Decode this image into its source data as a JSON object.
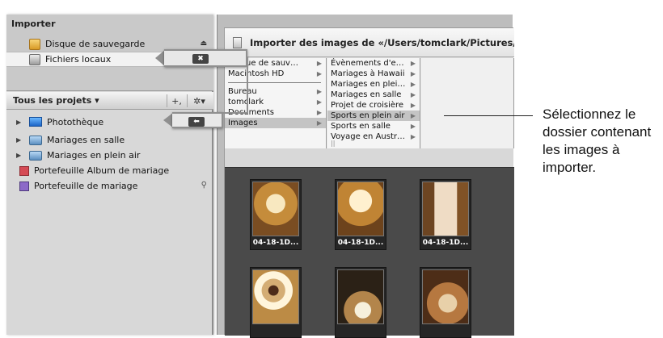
{
  "left_panel": {
    "import_section": {
      "title": "Importer",
      "items": [
        {
          "label": "Disque de sauvegarde",
          "eject": "⏏"
        },
        {
          "label": "Fichiers locaux"
        }
      ]
    },
    "projects": {
      "title": "Tous les projets ▾",
      "add_label": "+,",
      "action_label": "✲▾"
    },
    "tree": {
      "library": "Photothèque",
      "items": [
        {
          "label": "Mariages en salle",
          "type": "folder"
        },
        {
          "label": "Mariages en plein air",
          "type": "folder"
        },
        {
          "label": "Portefeuille Album de mariage",
          "type": "album"
        },
        {
          "label": "Portefeuille de mariage",
          "type": "portfolio"
        }
      ],
      "search_icon": "⚲"
    }
  },
  "browser": {
    "title": "Importer des images de «/Users/tomclark/Pictures/Indoo",
    "columns": {
      "col1": [
        {
          "label": "Disque de sauv…"
        },
        {
          "label": "Macintosh HD"
        },
        {
          "label": "Bureau"
        },
        {
          "label": "tomclark"
        },
        {
          "label": "Documents"
        },
        {
          "label": "Images",
          "selected": true
        }
      ],
      "col2": [
        {
          "label": "Évènements d'e…"
        },
        {
          "label": "Mariages à Hawaii"
        },
        {
          "label": "Mariages en plei…"
        },
        {
          "label": "Mariages en salle"
        },
        {
          "label": "Projet de croisière"
        },
        {
          "label": "Sports en plein air",
          "selected": true
        },
        {
          "label": "Sports en salle"
        },
        {
          "label": "Voyage en Austr…"
        }
      ]
    },
    "gallery": [
      {
        "label": "04-18-1D..."
      },
      {
        "label": "04-18-1D..."
      },
      {
        "label": "04-18-1D..."
      },
      {
        "label": ""
      },
      {
        "label": ""
      },
      {
        "label": ""
      }
    ]
  },
  "overlay": {
    "key1": "✖",
    "key2": "⬅"
  },
  "callout": {
    "text": "Sélectionnez le dossier contenant les images à importer."
  }
}
